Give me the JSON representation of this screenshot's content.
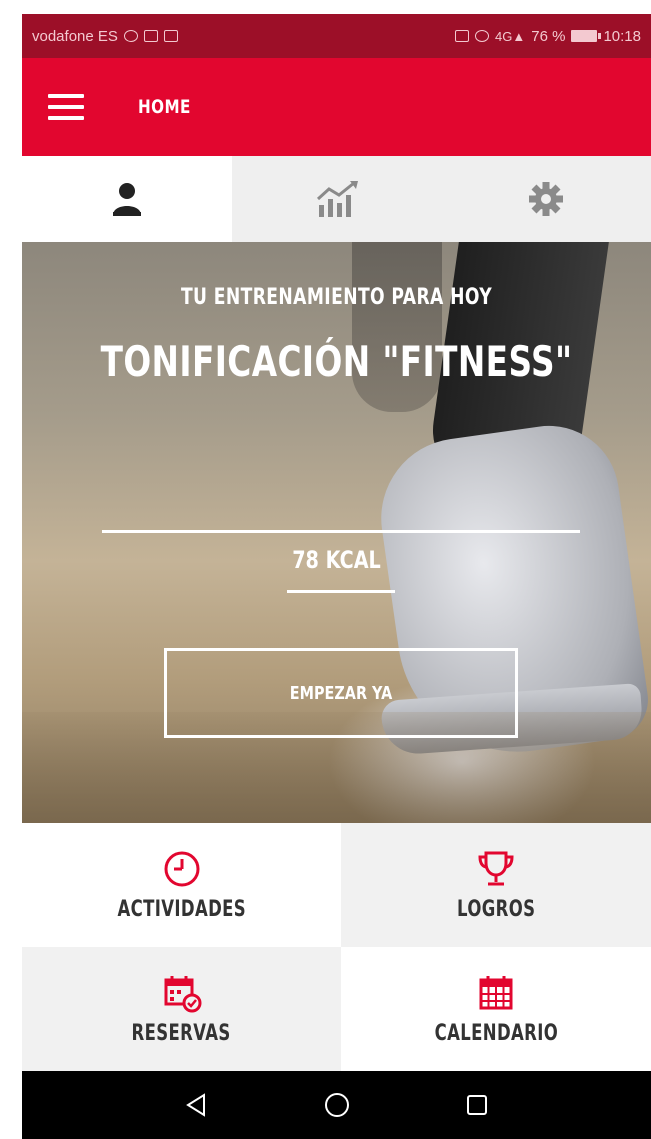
{
  "status_bar": {
    "carrier": "vodafone ES",
    "battery": "76 %",
    "time": "10:18"
  },
  "app_bar": {
    "title": "HOME"
  },
  "tabs": [
    {
      "icon": "person-icon",
      "active": true
    },
    {
      "icon": "stats-chart-icon",
      "active": false
    },
    {
      "icon": "gear-icon",
      "active": false
    }
  ],
  "hero": {
    "subtitle": "TU ENTRENAMIENTO PARA HOY",
    "title": "TONIFICACIÓN \"FITNESS\"",
    "kcal": "78 KCAL",
    "start_label": "EMPEZAR YA"
  },
  "menu": {
    "activities": {
      "label": "ACTIVIDADES",
      "icon": "clock-icon"
    },
    "achievements": {
      "label": "LOGROS",
      "icon": "trophy-icon"
    },
    "bookings": {
      "label": "RESERVAS",
      "icon": "calendar-check-icon"
    },
    "calendar": {
      "label": "CALENDARIO",
      "icon": "calendar-icon"
    }
  },
  "colors": {
    "accent": "#e2062f",
    "status_bar": "#9c0f28"
  }
}
